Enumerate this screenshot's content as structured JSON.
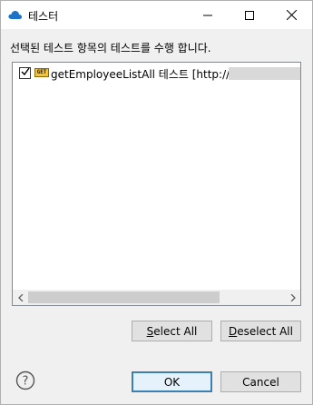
{
  "window": {
    "title": "테스터",
    "minimize_icon": "minimize-icon",
    "maximize_icon": "maximize-icon",
    "close_icon": "close-icon"
  },
  "instruction": "선택된 테스트 항목의 테스트를 수행 합니다.",
  "test_list": {
    "items": [
      {
        "checked": true,
        "method": "GET",
        "label": "getEmployeeListAll 테스트 [http://"
      }
    ]
  },
  "buttons": {
    "select_all_mnemonic": "S",
    "select_all_rest": "elect All",
    "deselect_all_mnemonic": "D",
    "deselect_all_rest": "eselect All",
    "ok": "OK",
    "cancel": "Cancel"
  },
  "help": {
    "symbol": "?"
  },
  "colors": {
    "accent": "#3c7fb1",
    "method_badge": "#f2c33c"
  }
}
